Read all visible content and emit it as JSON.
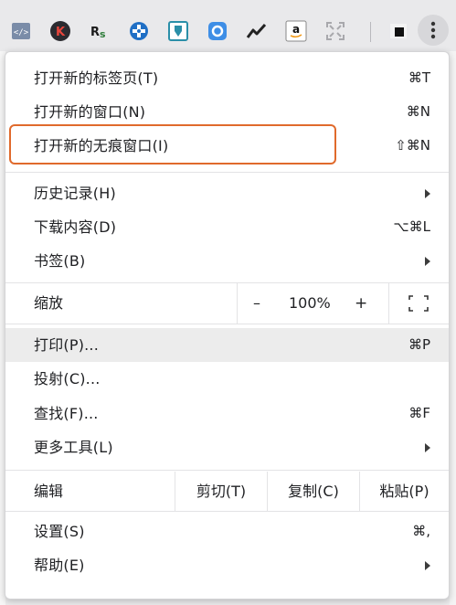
{
  "toolbar": {
    "icons": [
      {
        "name": "code-extension-icon",
        "glyph": "</>"
      },
      {
        "name": "k-extension-icon",
        "glyph": "K"
      },
      {
        "name": "rs-extension-icon",
        "glyph": "Rs"
      },
      {
        "name": "blue-cross-extension-icon",
        "glyph": ""
      },
      {
        "name": "teal-badge-extension-icon",
        "glyph": ""
      },
      {
        "name": "blue-circle-extension-icon",
        "glyph": ""
      },
      {
        "name": "trend-extension-icon",
        "glyph": ""
      },
      {
        "name": "amazon-extension-icon",
        "glyph": "a"
      },
      {
        "name": "expand-extension-icon",
        "glyph": ""
      },
      {
        "name": "square-extension-icon",
        "glyph": ""
      },
      {
        "name": "more-menu-icon",
        "glyph": "⋮"
      }
    ]
  },
  "menu": {
    "new_tab": {
      "label": "打开新的标签页(T)",
      "shortcut": "⌘T"
    },
    "new_window": {
      "label": "打开新的窗口(N)",
      "shortcut": "⌘N"
    },
    "new_incognito": {
      "label": "打开新的无痕窗口(I)",
      "shortcut": "⇧⌘N"
    },
    "history": {
      "label": "历史记录(H)"
    },
    "downloads": {
      "label": "下载内容(D)",
      "shortcut": "⌥⌘L"
    },
    "bookmarks": {
      "label": "书签(B)"
    },
    "zoom": {
      "label": "缩放",
      "minus": "–",
      "value": "100%",
      "plus": "+"
    },
    "print": {
      "label": "打印(P)...",
      "shortcut": "⌘P"
    },
    "cast": {
      "label": "投射(C)..."
    },
    "find": {
      "label": "查找(F)...",
      "shortcut": "⌘F"
    },
    "more_tools": {
      "label": "更多工具(L)"
    },
    "edit": {
      "label": "编辑",
      "cut": "剪切(T)",
      "copy": "复制(C)",
      "paste": "粘贴(P)"
    },
    "settings": {
      "label": "设置(S)",
      "shortcut": "⌘,"
    },
    "help": {
      "label": "帮助(E)"
    }
  },
  "colors": {
    "highlight": "#ececec",
    "annotation": "#e06a2c"
  }
}
